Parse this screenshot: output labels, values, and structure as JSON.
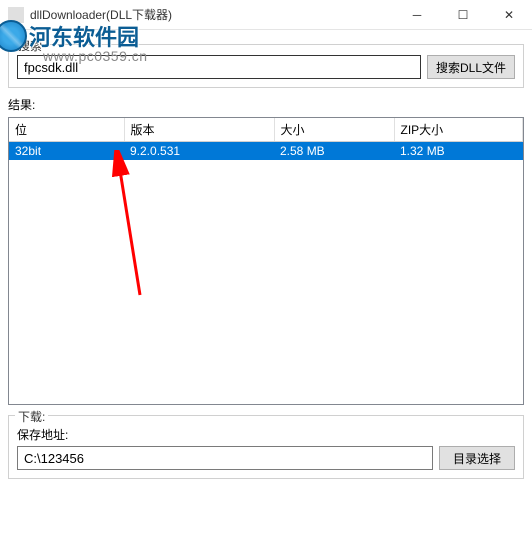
{
  "window": {
    "title": "dllDownloader(DLL下载器)"
  },
  "watermark": {
    "title": "河东软件园",
    "url": "www.pc0359.cn"
  },
  "search": {
    "legend": "搜索",
    "input_value": "fpcsdk.dll",
    "button": "搜索DLL文件"
  },
  "results": {
    "label": "结果:",
    "columns": {
      "bit": "位",
      "version": "版本",
      "size": "大小",
      "zipsize": "ZIP大小"
    },
    "rows": [
      {
        "bit": "32bit",
        "version": "9.2.0.531",
        "size": "2.58 MB",
        "zipsize": "1.32 MB"
      }
    ]
  },
  "download": {
    "legend": "下载:",
    "path_label": "保存地址:",
    "path_value": "C:\\123456",
    "folder_button": "目录选择"
  }
}
